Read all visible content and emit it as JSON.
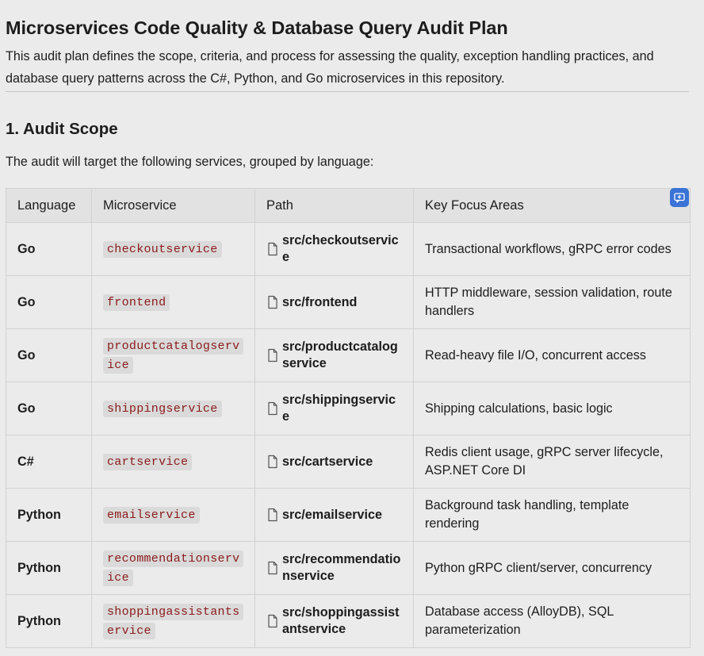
{
  "document": {
    "title": "Microservices Code Quality & Database Query Audit Plan",
    "intro": "This audit plan defines the scope, criteria, and process for assessing the quality, exception handling practices, and database query patterns across the C#, Python, and Go microservices in this repository.",
    "section1_heading": "1. Audit Scope",
    "section1_lead": "The audit will target the following services, grouped by language:"
  },
  "table": {
    "headers": {
      "language": "Language",
      "microservice": "Microservice",
      "path": "Path",
      "focus": "Key Focus Areas"
    },
    "rows": [
      {
        "language": "Go",
        "microservice": "checkoutservice",
        "path": "src/checkoutservice",
        "focus": "Transactional workflows, gRPC error codes"
      },
      {
        "language": "Go",
        "microservice": "frontend",
        "path": "src/frontend",
        "focus": "HTTP middleware, session validation, route handlers"
      },
      {
        "language": "Go",
        "microservice": "productcatalogservice",
        "path": "src/productcatalogservice",
        "focus": "Read-heavy file I/O, concurrent access"
      },
      {
        "language": "Go",
        "microservice": "shippingservice",
        "path": "src/shippingservice",
        "focus": "Shipping calculations, basic logic"
      },
      {
        "language": "C#",
        "microservice": "cartservice",
        "path": "src/cartservice",
        "focus": "Redis client usage, gRPC server lifecycle, ASP.NET Core DI"
      },
      {
        "language": "Python",
        "microservice": "emailservice",
        "path": "src/emailservice",
        "focus": "Background task handling, template rendering"
      },
      {
        "language": "Python",
        "microservice": "recommendationservice",
        "path": "src/recommendationservice",
        "focus": "Python gRPC client/server, concurrency"
      },
      {
        "language": "Python",
        "microservice": "shoppingassistantservice",
        "path": "src/shoppingassistantservice",
        "focus": "Database access (AlloyDB), SQL parameterization"
      }
    ]
  },
  "icons": {
    "path_icon": "file-icon",
    "comment_button_icon": "add-comment-icon"
  },
  "colors": {
    "background": "#ebebeb",
    "code_text": "#8b1a1a",
    "code_bg": "#dadada",
    "accent": "#3a73d6"
  }
}
